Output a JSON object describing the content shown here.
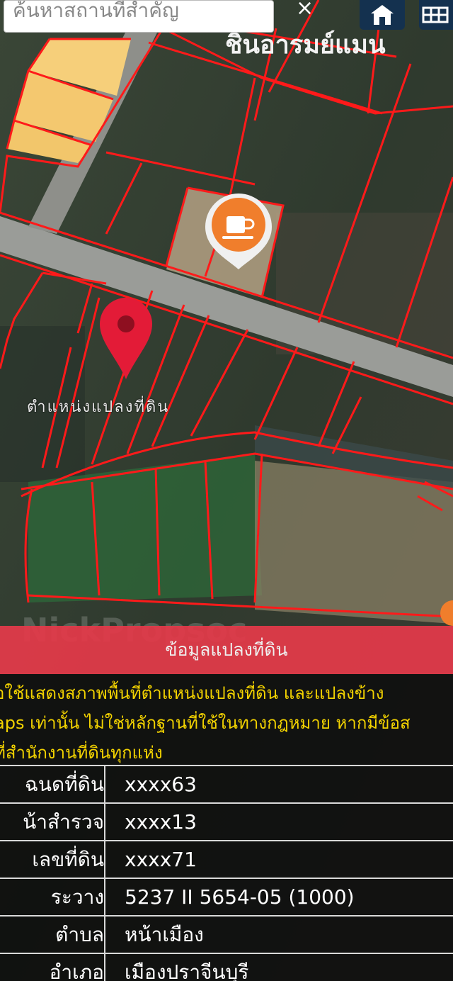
{
  "search": {
    "placeholder": "ค้นหาสถานที่สำคัญ",
    "close": "×"
  },
  "toolbar": {
    "home_icon": "home-icon",
    "layers_icon": "grid-icon"
  },
  "map": {
    "place_label": "ชินอารมย์แมน",
    "marker_label": "ตำแหน่งแปลงที่ดิน",
    "watermark": "NickPropsoc",
    "poi_icon": "coffee-icon",
    "colors": {
      "parcel_line": "#ff1a1a",
      "road": "#9a9c98",
      "highlight_parcel": "#f6cf7a"
    }
  },
  "info": {
    "title": "ข้อมูลแปลงที่ดิน",
    "notice": [
      "อใช้แสดงสภาพพื้นที่ตำแหน่งแปลงที่ดิน และแปลงข้าง",
      "aps เท่านั้น ไม่ใช่หลักฐานที่ใช้ในทางกฎหมาย หากมีข้อส",
      "ที่สำนักงานที่ดินทุกแห่ง"
    ],
    "rows": [
      {
        "key": "ฉนดที่ดิน",
        "value": "xxxx63"
      },
      {
        "key": "น้าสำรวจ",
        "value": "xxxx13"
      },
      {
        "key": "เลขที่ดิน",
        "value": "xxxx71"
      },
      {
        "key": "ระวาง",
        "value": "5237 II 5654-05 (1000)"
      },
      {
        "key": "ตำบล",
        "value": "หน้าเมือง"
      },
      {
        "key": "อำเภอ",
        "value": "เมืองปราจีนบุรี"
      }
    ]
  }
}
